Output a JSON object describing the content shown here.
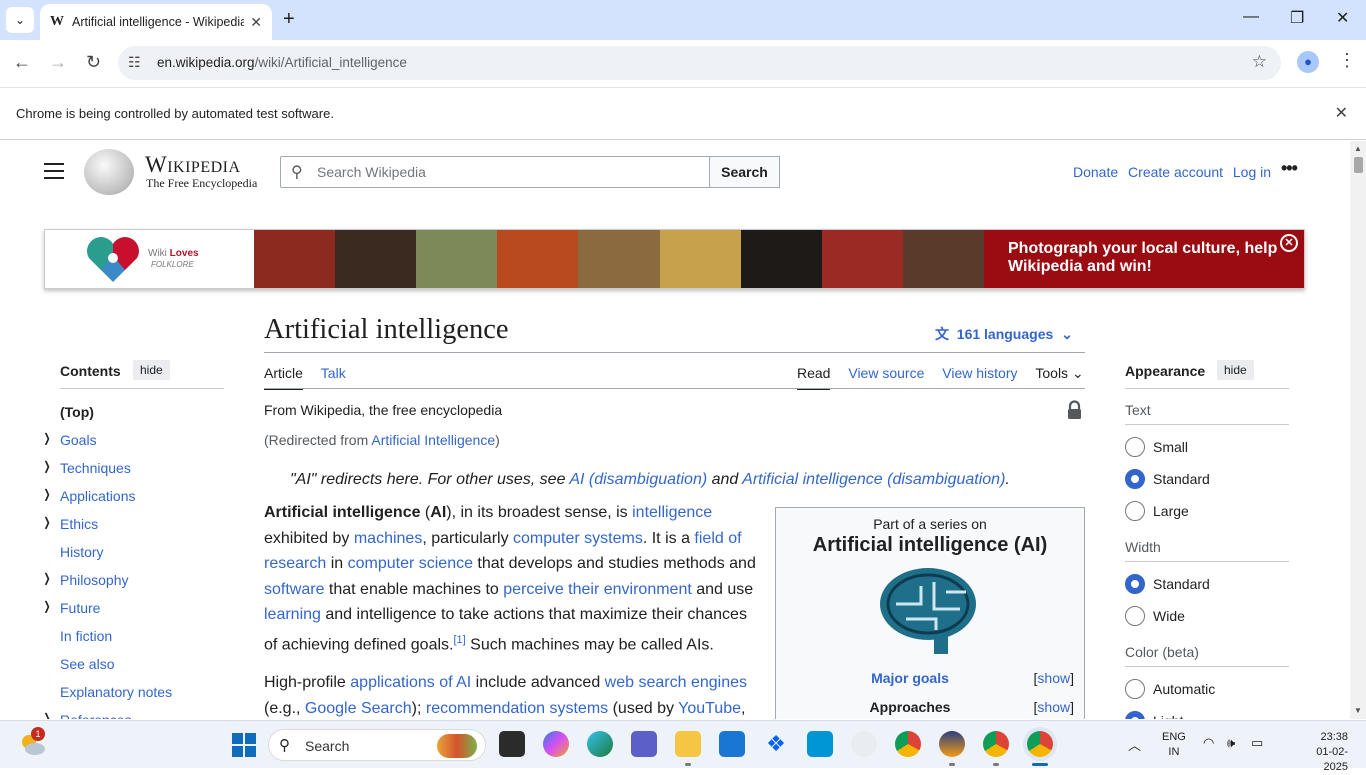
{
  "browser": {
    "tab_title": "Artificial intelligence - Wikipedia",
    "tab_favicon": "W",
    "url_host": "en.wikipedia.org",
    "url_path": "/wiki/Artificial_intelligence",
    "infobar_message": "Chrome is being controlled by automated test software."
  },
  "header": {
    "wordmark": "Wikipedia",
    "tagline": "The Free Encyclopedia",
    "search_placeholder": "Search Wikipedia",
    "search_button": "Search",
    "donate": "Donate",
    "create_account": "Create account",
    "log_in": "Log in",
    "more": "•••"
  },
  "banner": {
    "logo_line1": "Wiki",
    "logo_line1_bold": "Loves",
    "logo_line2": "FOLKLORE",
    "cta": "Photograph your local culture, help Wikipedia and win!",
    "close": "✕",
    "photo_colors": [
      "#8c2a1f",
      "#3b2a20",
      "#7d8a58",
      "#b84a1e",
      "#8a6a3e",
      "#c8a24a",
      "#1d1a18",
      "#9b2a25",
      "#5a3a2a"
    ]
  },
  "article": {
    "title": "Artificial intelligence",
    "languages": "161 languages",
    "tab_article": "Article",
    "tab_talk": "Talk",
    "tab_read": "Read",
    "tab_view_source": "View source",
    "tab_view_history": "View history",
    "tab_tools": "Tools",
    "from": "From Wikipedia, the free encyclopedia",
    "redirect_prefix": "(Redirected from ",
    "redirect_link": "Artificial Intelligence",
    "redirect_suffix": ")",
    "hatnote_1": "\"AI\" redirects here. For other uses, see ",
    "hatnote_link1": "AI (disambiguation)",
    "hatnote_2": " and ",
    "hatnote_link2": "Artificial intelligence (disambiguation)",
    "hatnote_3": ".",
    "p1": {
      "t1": "Artificial intelligence",
      "t2": " (",
      "t3": "AI",
      "t4": "), in its broadest sense, is ",
      "l1": "intelligence",
      "t5": " exhibited by ",
      "l2": "machines",
      "t6": ", particularly ",
      "l3": "computer systems",
      "t7": ". It is a ",
      "l4": "field of research",
      "t8": " in ",
      "l5": "computer science",
      "t9": " that develops and studies methods and ",
      "l6": "software",
      "t10": " that enable machines to ",
      "l7": "perceive their environment",
      "t11": " and use ",
      "l8": "learning",
      "t12": " and intelligence to take actions that maximize their chances of achieving defined goals.",
      "ref": "[1]",
      "t13": " Such machines may be called AIs."
    },
    "p2": {
      "t1": "High-profile ",
      "l1": "applications of AI",
      "t2": " include advanced ",
      "l2": "web search engines",
      "t3": " (e.g., ",
      "l3": "Google Search",
      "t4": "); ",
      "l4": "recommendation systems",
      "t5": " (used by ",
      "l5": "YouTube",
      "t6": ","
    }
  },
  "infobox": {
    "series": "Part of a series on",
    "title": "Artificial intelligence (AI)",
    "row1": "Major goals",
    "row2": "Approaches",
    "show": "show"
  },
  "toc": {
    "heading": "Contents",
    "hide": "hide",
    "items": [
      {
        "label": "(Top)",
        "expandable": false
      },
      {
        "label": "Goals",
        "expandable": true
      },
      {
        "label": "Techniques",
        "expandable": true
      },
      {
        "label": "Applications",
        "expandable": true
      },
      {
        "label": "Ethics",
        "expandable": true
      },
      {
        "label": "History",
        "expandable": false
      },
      {
        "label": "Philosophy",
        "expandable": true
      },
      {
        "label": "Future",
        "expandable": true
      },
      {
        "label": "In fiction",
        "expandable": false
      },
      {
        "label": "See also",
        "expandable": false
      },
      {
        "label": "Explanatory notes",
        "expandable": false
      },
      {
        "label": "References",
        "expandable": true
      }
    ]
  },
  "appearance": {
    "heading": "Appearance",
    "hide": "hide",
    "text_label": "Text",
    "text_options": [
      "Small",
      "Standard",
      "Large"
    ],
    "text_selected": "Standard",
    "width_label": "Width",
    "width_options": [
      "Standard",
      "Wide"
    ],
    "width_selected": "Standard",
    "color_label": "Color (beta)",
    "color_options": [
      "Automatic",
      "Light"
    ],
    "color_selected": "Light"
  },
  "taskbar": {
    "search": "Search",
    "weather_badge": "1",
    "lang_line1": "ENG",
    "lang_line2": "IN",
    "time": "23:38",
    "date": "01-02-2025",
    "accent": "#0f6cbd"
  }
}
